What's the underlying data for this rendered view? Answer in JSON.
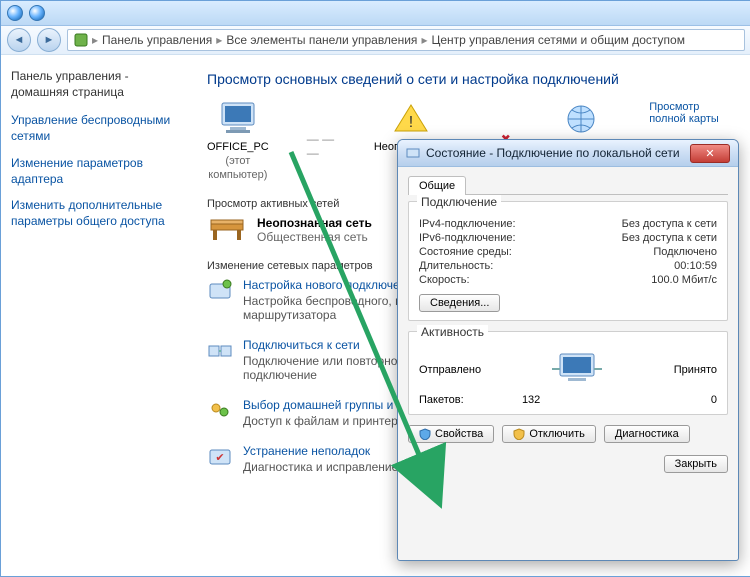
{
  "breadcrumb": {
    "p1": "Панель управления",
    "p2": "Все элементы панели управления",
    "p3": "Центр управления сетями и общим доступом"
  },
  "sidebar": {
    "heading": "Панель управления - домашняя страница",
    "items": [
      {
        "label": "Управление беспроводными сетями"
      },
      {
        "label": "Изменение параметров адаптера"
      },
      {
        "label": "Изменить дополнительные параметры общего доступа"
      }
    ]
  },
  "page": {
    "title": "Просмотр основных сведений о сети и настройка подключений",
    "fullmap": "Просмотр полной карты",
    "nodes": {
      "pc": {
        "name": "OFFICE_PC",
        "sub": "(этот компьютер)"
      },
      "unknown": "Неопознанная сеть",
      "internet": "Интернет"
    },
    "active_heading": "Просмотр активных сетей",
    "active": {
      "title": "Неопознанная сеть",
      "sub": "Общественная сеть"
    },
    "settings_heading": "Изменение сетевых параметров",
    "tasks": [
      {
        "title": "Настройка нового подключения",
        "desc": "Настройка беспроводного, широкополосного, модемного, или же настройка маршрутизатора"
      },
      {
        "title": "Подключиться к сети",
        "desc": "Подключение или повторное подключение к беспроводному, сетевому соединению или подключение"
      },
      {
        "title": "Выбор домашней группы и параметров",
        "desc": "Доступ к файлам и принтерам, изменение параметров общего доступа"
      },
      {
        "title": "Устранение неполадок",
        "desc": "Диагностика и исправление сетевых проблем"
      }
    ]
  },
  "popup": {
    "title": "Состояние - Подключение по локальной сети",
    "tab": "Общие",
    "conn_group": "Подключение",
    "conn": {
      "ipv4_k": "IPv4-подключение:",
      "ipv4_v": "Без доступа к сети",
      "ipv6_k": "IPv6-подключение:",
      "ipv6_v": "Без доступа к сети",
      "media_k": "Состояние среды:",
      "media_v": "Подключено",
      "dur_k": "Длительность:",
      "dur_v": "00:10:59",
      "spd_k": "Скорость:",
      "spd_v": "100.0 Мбит/с"
    },
    "details_btn": "Сведения...",
    "act_group": "Активность",
    "act": {
      "sent": "Отправлено",
      "recv": "Принято",
      "pkt_k": "Пакетов:",
      "pkt_sent": "132",
      "pkt_recv": "0"
    },
    "btn_props": "Свойства",
    "btn_disable": "Отключить",
    "btn_diag": "Диагностика",
    "btn_close": "Закрыть"
  }
}
